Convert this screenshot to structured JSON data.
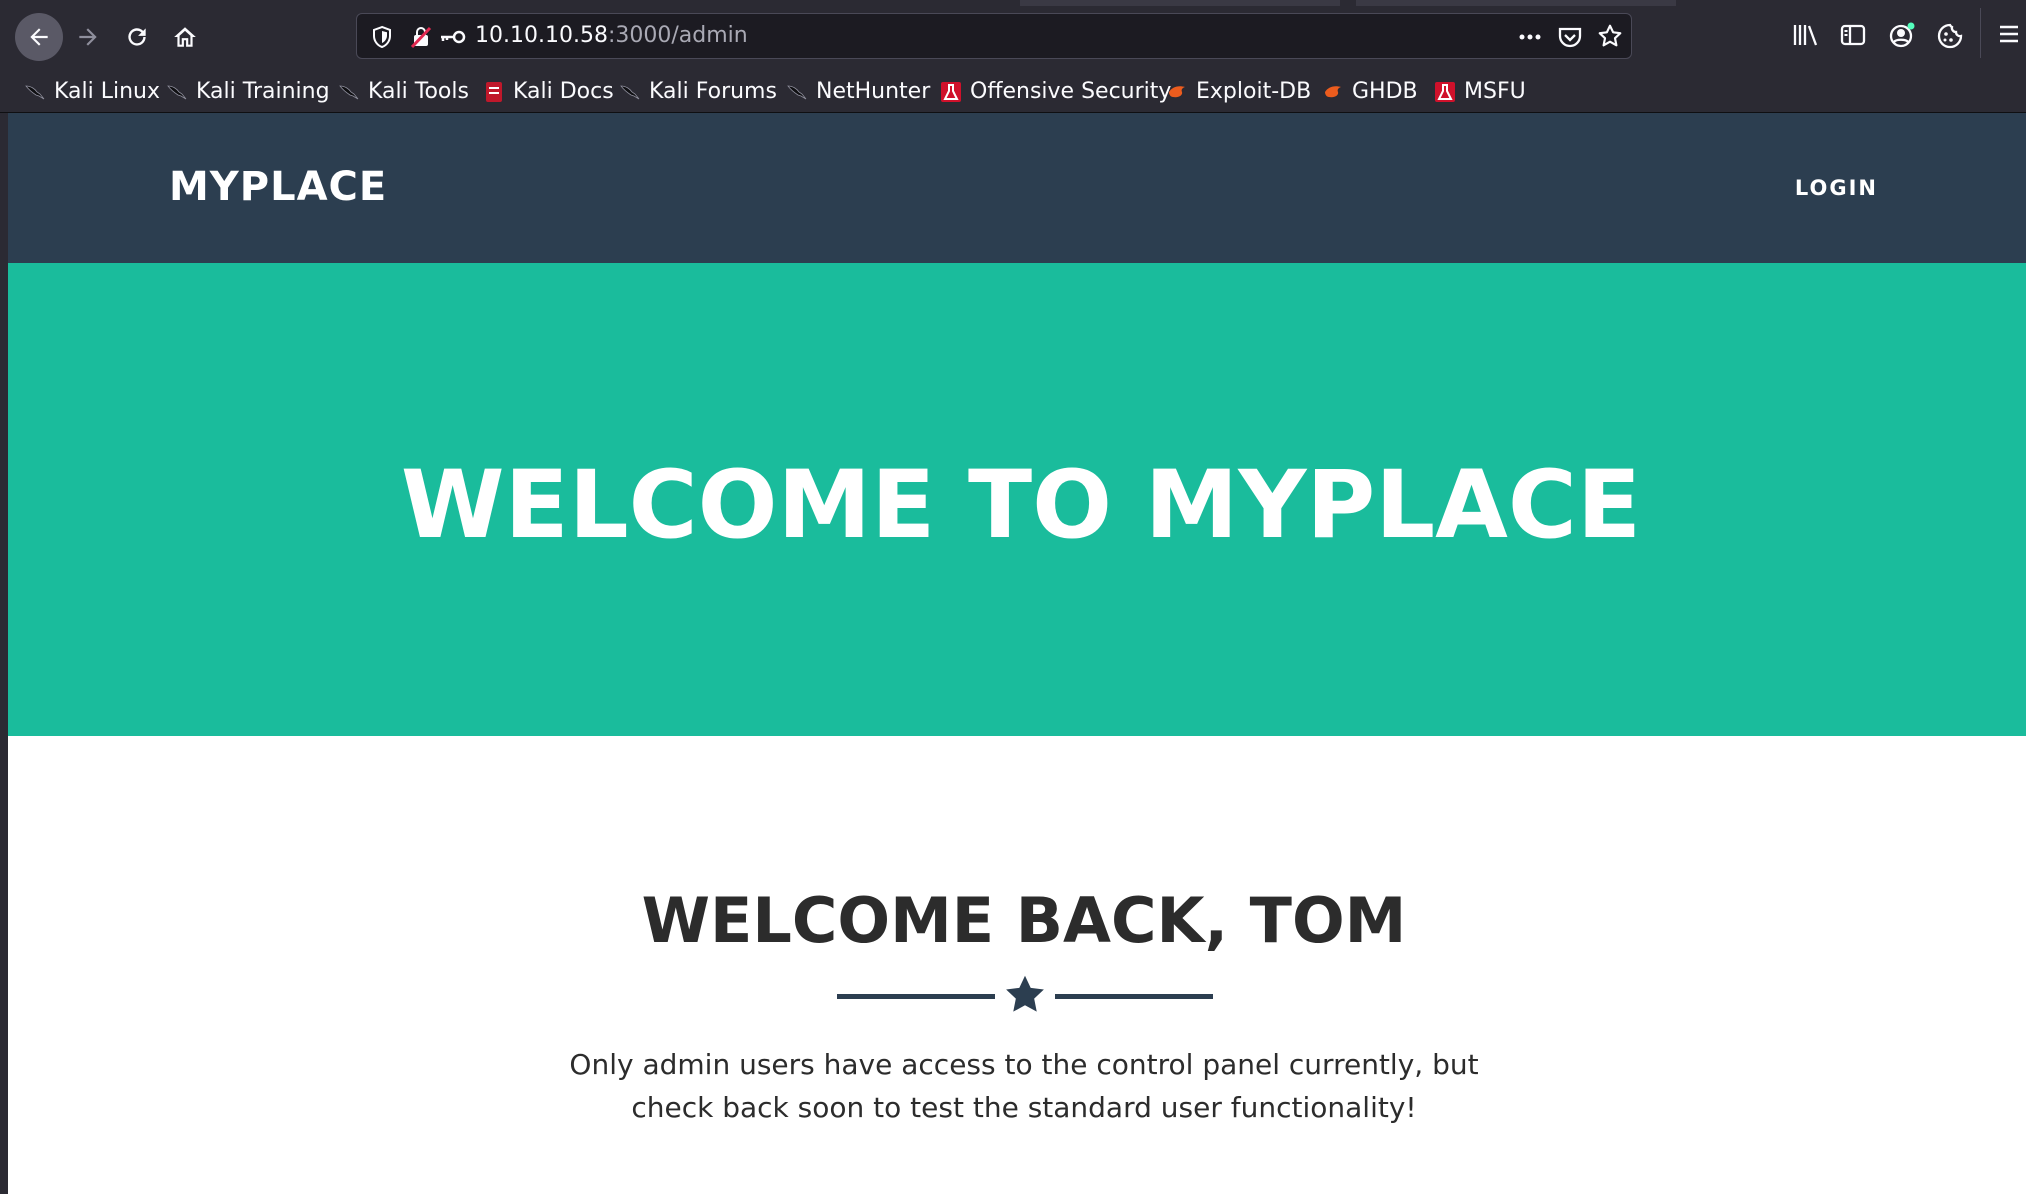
{
  "browser": {
    "url_host": "10.10.10.58",
    "url_path": ":3000/admin",
    "bookmarks": [
      {
        "label": "Kali Linux",
        "icon": "kali-dragon-icon"
      },
      {
        "label": "Kali Training",
        "icon": "kali-dragon-icon"
      },
      {
        "label": "Kali Tools",
        "icon": "kali-dragon-icon"
      },
      {
        "label": "Kali Docs",
        "icon": "kali-docs-icon"
      },
      {
        "label": "Kali Forums",
        "icon": "kali-dragon-icon"
      },
      {
        "label": "NetHunter",
        "icon": "kali-dragon-icon"
      },
      {
        "label": "Offensive Security",
        "icon": "offsec-icon"
      },
      {
        "label": "Exploit-DB",
        "icon": "exploit-db-icon"
      },
      {
        "label": "GHDB",
        "icon": "exploit-db-icon"
      },
      {
        "label": "MSFU",
        "icon": "offsec-icon"
      }
    ]
  },
  "site": {
    "brand": "MYPLACE",
    "nav_login": "LOGIN",
    "hero_title": "WELCOME TO MYPLACE",
    "welcome_heading": "WELCOME BACK, TOM",
    "body_line_1": "Only admin users have access to the control panel currently, but",
    "body_line_2": "check back soon to test the standard user functionality!"
  },
  "colors": {
    "browser_chrome": "#2b2a33",
    "navbar": "#2c3e50",
    "hero": "#1abc9c",
    "heading_text": "#2c2c2c"
  }
}
